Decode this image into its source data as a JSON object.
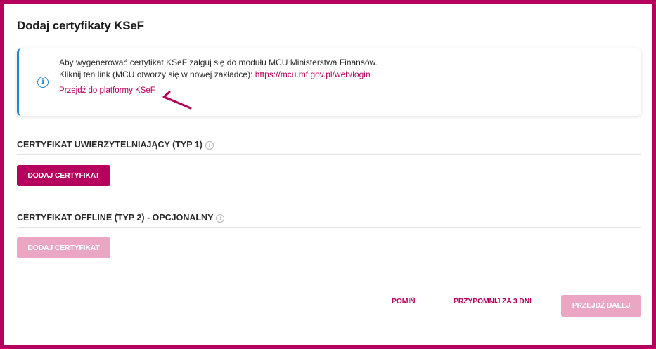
{
  "title": "Dodaj certyfikaty KSeF",
  "info": {
    "line1": "Aby wygenerować certyfikat KSeF zalguj się do modułu MCU Ministerstwa Finansów.",
    "line2_prefix": "Kliknij ten link (MCU otworzy się w nowej zakładce): ",
    "line2_link": "https://mcu.mf.gov.pl/web/login",
    "ksef_link": "Przejdź do platformy KSeF",
    "icon": "info-icon",
    "accent": "#1e88d6"
  },
  "sections": [
    {
      "title": "CERTYFIKAT UWIERZYTELNIAJĄCY (TYP 1)",
      "button": "DODAJ CERTYFIKAT",
      "button_state": "enabled"
    },
    {
      "title": "CERTYFIKAT OFFLINE (TYP 2) - OPCJONALNY",
      "button": "DODAJ CERTYFIKAT",
      "button_state": "disabled"
    }
  ],
  "footer": {
    "skip": "POMIŃ",
    "remind": "PRZYPOMNIJ ZA 3 DNI",
    "next": "PRZEJDŹ DALEJ"
  },
  "colors": {
    "brand": "#b5005d",
    "brand_disabled": "#eba6c4",
    "info": "#1e88d6"
  }
}
